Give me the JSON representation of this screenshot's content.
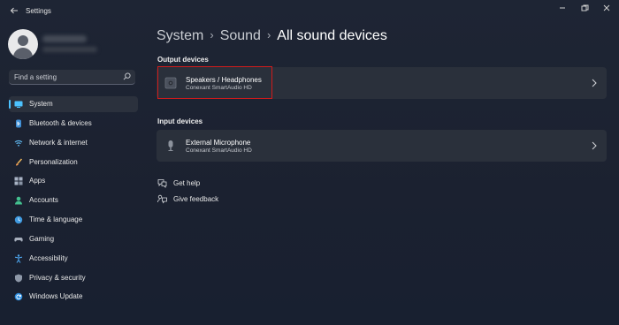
{
  "window": {
    "title": "Settings",
    "controls": [
      "minimize",
      "maximize",
      "close"
    ]
  },
  "search": {
    "placeholder": "Find a setting"
  },
  "sidebar": {
    "items": [
      {
        "label": "System",
        "icon": "system-icon",
        "selected": true
      },
      {
        "label": "Bluetooth & devices",
        "icon": "bluetooth-icon"
      },
      {
        "label": "Network & internet",
        "icon": "wifi-icon"
      },
      {
        "label": "Personalization",
        "icon": "brush-icon"
      },
      {
        "label": "Apps",
        "icon": "apps-icon"
      },
      {
        "label": "Accounts",
        "icon": "accounts-icon"
      },
      {
        "label": "Time & language",
        "icon": "globe-clock-icon"
      },
      {
        "label": "Gaming",
        "icon": "gamepad-icon"
      },
      {
        "label": "Accessibility",
        "icon": "accessibility-icon"
      },
      {
        "label": "Privacy & security",
        "icon": "shield-icon"
      },
      {
        "label": "Windows Update",
        "icon": "update-icon"
      }
    ]
  },
  "breadcrumb": {
    "items": [
      "System",
      "Sound"
    ],
    "current": "All sound devices",
    "separator": "›"
  },
  "output": {
    "heading": "Output devices",
    "devices": [
      {
        "name": "Speakers / Headphones",
        "subtitle": "Conexant SmartAudio HD",
        "icon": "speaker-icon"
      }
    ]
  },
  "input": {
    "heading": "Input devices",
    "devices": [
      {
        "name": "External Microphone",
        "subtitle": "Conexant SmartAudio HD",
        "icon": "microphone-icon"
      }
    ]
  },
  "links": {
    "help": "Get help",
    "feedback": "Give feedback"
  },
  "colors": {
    "accent": "#4cc2ff",
    "highlight_box": "#d11b1b",
    "background": "#1c2330",
    "card": "#2a303b"
  }
}
